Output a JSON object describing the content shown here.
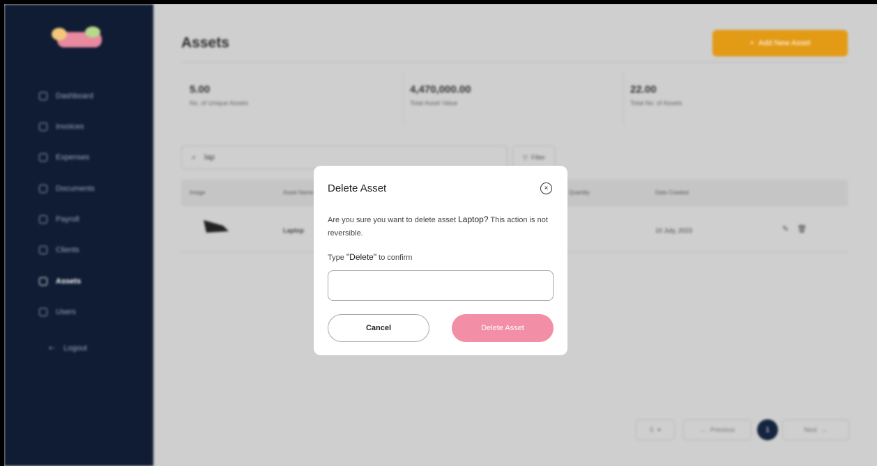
{
  "sidebar": {
    "items": [
      {
        "label": "Dashboard"
      },
      {
        "label": "Invoices"
      },
      {
        "label": "Expenses"
      },
      {
        "label": "Documents"
      },
      {
        "label": "Payroll"
      },
      {
        "label": "Clients"
      },
      {
        "label": "Assets"
      },
      {
        "label": "Users"
      }
    ],
    "logout": "Logout"
  },
  "header": {
    "title": "Assets",
    "add_button": "Add New Asset",
    "add_icon": "+"
  },
  "stats": [
    {
      "value": "5.00",
      "label": "No. of Unique Assets"
    },
    {
      "value": "4,470,000.00",
      "label": "Total Asset Value"
    },
    {
      "value": "22.00",
      "label": "Total No. of Assets"
    }
  ],
  "search": {
    "value": "lap"
  },
  "filter": {
    "label": "Filter"
  },
  "table": {
    "headers": [
      "Image",
      "Asset Name",
      "Quantity",
      "Date Created"
    ],
    "rows": [
      {
        "name": "Laptop",
        "date": "10 July, 2023"
      }
    ]
  },
  "pagination": {
    "page_size": "5",
    "previous": "Previous",
    "current_page": "1",
    "next": "Next"
  },
  "modal": {
    "title": "Delete Asset",
    "message_prefix": "Are you sure you want to delete asset ",
    "asset_name": "Laptop?",
    "message_suffix": " This action is not reversible.",
    "confirm_prefix": "Type ",
    "confirm_keyword": "\"Delete\"",
    "confirm_suffix": " to confirm",
    "input_value": "",
    "cancel_label": "Cancel",
    "delete_label": "Delete Asset",
    "close_glyph": "×"
  },
  "colors": {
    "sidebar_bg": "#0f1c33",
    "accent_orange": "#e39a15",
    "delete_pink": "#f28ea6",
    "overlay_bg": "#cfcfcf"
  }
}
